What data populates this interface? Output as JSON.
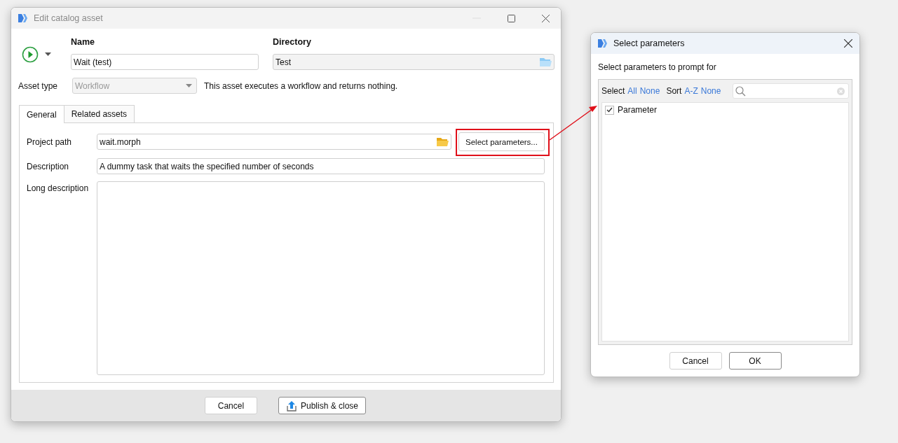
{
  "main_window": {
    "title": "Edit catalog asset",
    "name": {
      "label": "Name",
      "value": "Wait (test)"
    },
    "directory": {
      "label": "Directory",
      "value": "Test"
    },
    "asset_type": {
      "label": "Asset type",
      "value": "Workflow",
      "disabled": true,
      "description": "This asset executes a workflow and returns nothing."
    },
    "tabs": [
      {
        "label": "General",
        "selected": true
      },
      {
        "label": "Related assets",
        "selected": false
      }
    ],
    "project_path": {
      "label": "Project path",
      "value": "wait.morph"
    },
    "select_parameters_button": {
      "label": "Select parameters...",
      "highlighted": true
    },
    "description": {
      "label": "Description",
      "value": "A dummy task that waits the specified number of seconds"
    },
    "long_description": {
      "label": "Long description"
    },
    "buttons": [
      {
        "label": "Cancel",
        "kind": "plain"
      },
      {
        "label": "Publish & close",
        "kind": "publish"
      }
    ]
  },
  "dialog": {
    "title": "Select parameters",
    "prompt": "Select parameters to prompt for",
    "select_label": "Select",
    "select_links": [
      "All",
      "None"
    ],
    "sort_label": "Sort",
    "sort_links": [
      "A-Z",
      "None"
    ],
    "items": [
      {
        "label": "Parameter",
        "checked": true
      }
    ],
    "buttons": [
      {
        "label": "Cancel",
        "default": false
      },
      {
        "label": "OK",
        "default": true
      }
    ]
  }
}
